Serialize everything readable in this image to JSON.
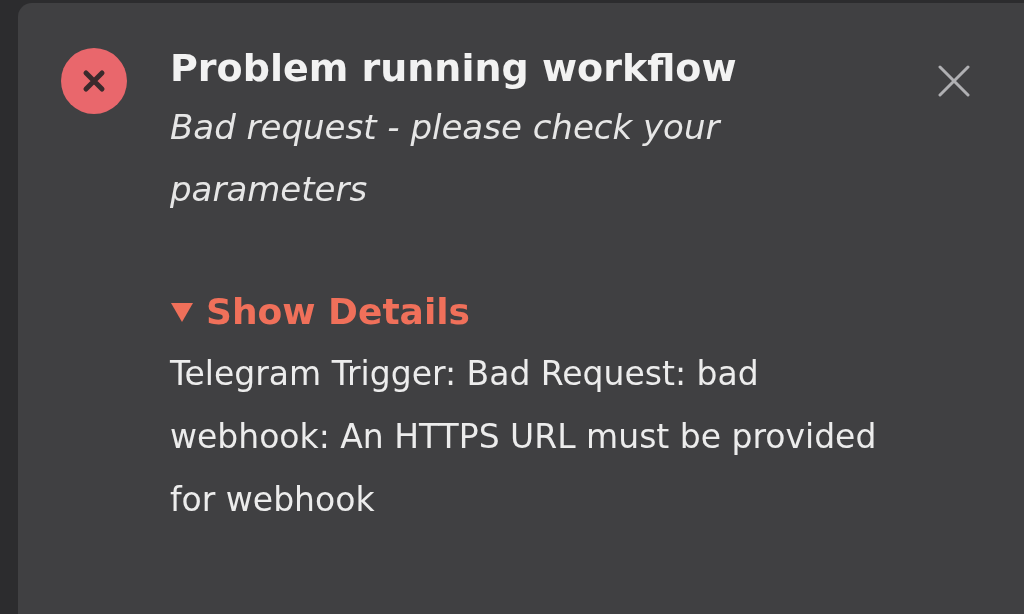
{
  "notification": {
    "title": "Problem running workflow",
    "message": "Bad request - please check your parameters",
    "details_toggle": {
      "label": "Show Details",
      "expanded": true
    },
    "details": "Telegram Trigger: Bad Request: bad webhook: An HTTPS URL must be provided for webhook"
  }
}
